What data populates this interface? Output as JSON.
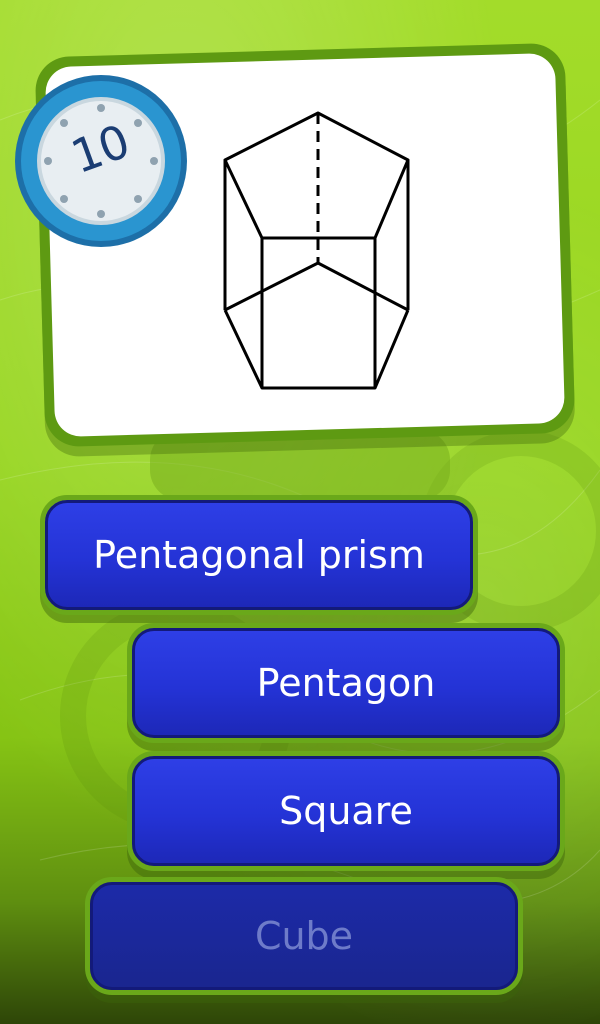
{
  "timer": {
    "value": "10",
    "icon": "clock-icon"
  },
  "question": {
    "figure": "pentagonal-prism-drawing"
  },
  "answers": [
    {
      "label": "Pentagonal prism"
    },
    {
      "label": "Pentagon"
    },
    {
      "label": "Square"
    },
    {
      "label": "Cube"
    }
  ],
  "colors": {
    "background": "#96d51e",
    "card_border": "#5e9a12",
    "button": "#2433d6",
    "timer_ring": "#1f88c4"
  }
}
